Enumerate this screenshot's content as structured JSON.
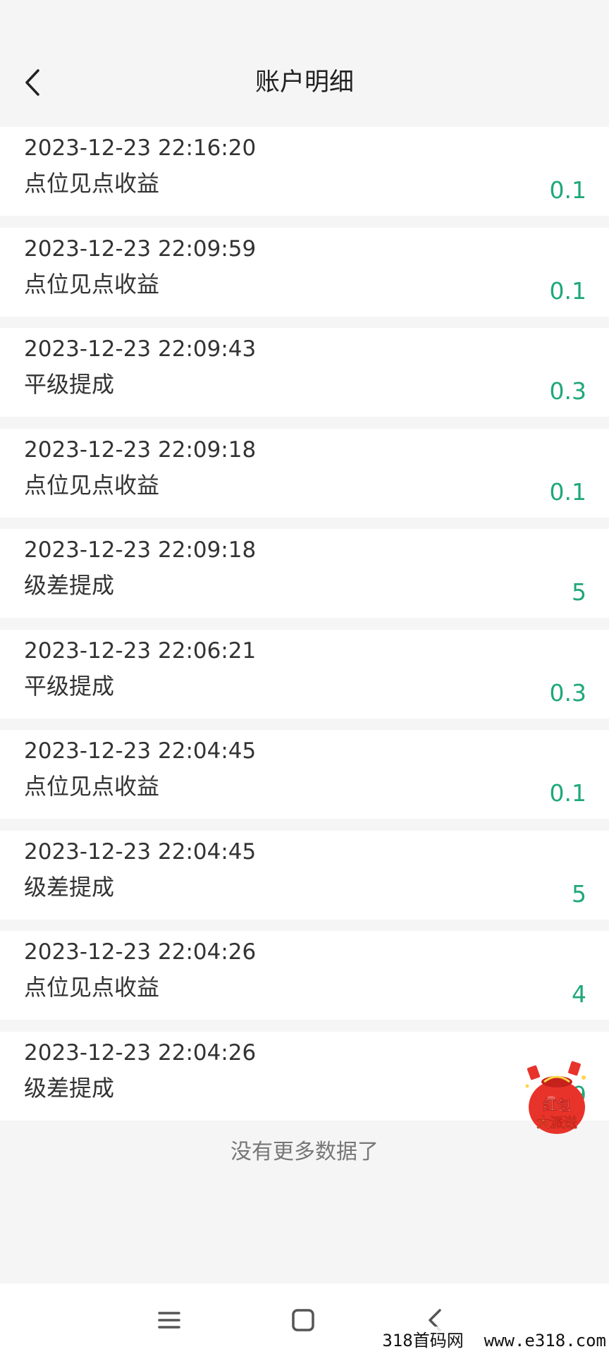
{
  "header": {
    "title": "账户明细"
  },
  "records": [
    {
      "time": "2023-12-23 22:16:20",
      "type": "点位见点收益",
      "amount": "0.1"
    },
    {
      "time": "2023-12-23 22:09:59",
      "type": "点位见点收益",
      "amount": "0.1"
    },
    {
      "time": "2023-12-23 22:09:43",
      "type": "平级提成",
      "amount": "0.3"
    },
    {
      "time": "2023-12-23 22:09:18",
      "type": "点位见点收益",
      "amount": "0.1"
    },
    {
      "time": "2023-12-23 22:09:18",
      "type": "级差提成",
      "amount": "5"
    },
    {
      "time": "2023-12-23 22:06:21",
      "type": "平级提成",
      "amount": "0.3"
    },
    {
      "time": "2023-12-23 22:04:45",
      "type": "点位见点收益",
      "amount": "0.1"
    },
    {
      "time": "2023-12-23 22:04:45",
      "type": "级差提成",
      "amount": "5"
    },
    {
      "time": "2023-12-23 22:04:26",
      "type": "点位见点收益",
      "amount": "4"
    },
    {
      "time": "2023-12-23 22:04:26",
      "type": "级差提成",
      "amount": "9"
    }
  ],
  "footer": {
    "no_more": "没有更多数据了"
  },
  "promo": {
    "line1": "红包",
    "line2": "大派送"
  },
  "watermark": "318首码网  www.e318.com",
  "colors": {
    "amount": "#1ea879",
    "promo_red": "#e8332b",
    "promo_gold": "#ffd54a"
  },
  "icons": {
    "back": "chevron-left-icon",
    "menu": "menu-icon",
    "home": "square-icon",
    "nav_back": "chevron-left-icon"
  }
}
